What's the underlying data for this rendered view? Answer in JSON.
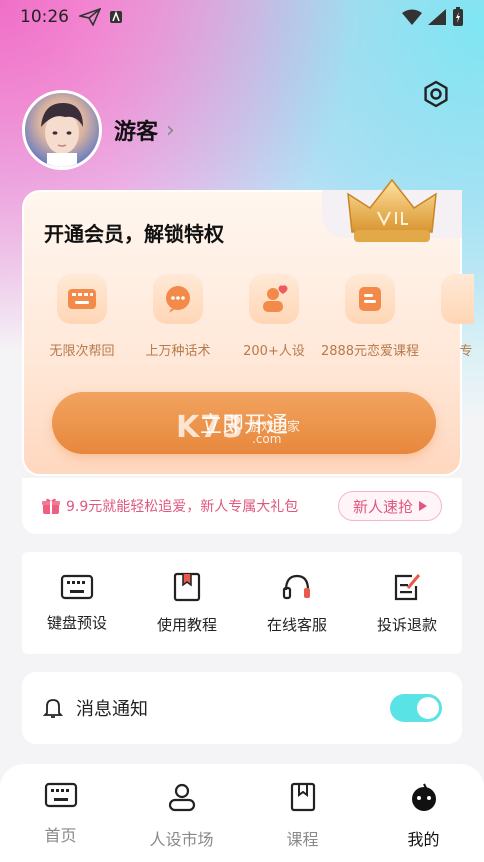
{
  "status_bar": {
    "time": "10:26"
  },
  "profile": {
    "username": "游客"
  },
  "vip": {
    "title": "开通会员，解锁特权",
    "perks": [
      {
        "label": "无限次帮回",
        "icon": "keyboard-icon"
      },
      {
        "label": "上万种话术",
        "icon": "chat-bubble-icon"
      },
      {
        "label": "200+人设",
        "icon": "persona-icon"
      },
      {
        "label": "2888元恋爱课程",
        "icon": "course-icon"
      },
      {
        "label": "专",
        "icon": "more-icon"
      }
    ],
    "join_label": "立即开通"
  },
  "watermark": {
    "main": "K73",
    "sub1": "游戏之家",
    "sub2": ".com"
  },
  "promo": {
    "text": "9.9元就能轻松追爱，新人专属大礼包",
    "button": "新人速抢"
  },
  "tools": [
    {
      "label": "键盘预设",
      "icon": "keyboard-icon"
    },
    {
      "label": "使用教程",
      "icon": "tutorial-book-icon"
    },
    {
      "label": "在线客服",
      "icon": "headset-icon"
    },
    {
      "label": "投诉退款",
      "icon": "complaint-edit-icon"
    }
  ],
  "notification": {
    "label": "消息通知",
    "enabled": true
  },
  "bottom_nav": [
    {
      "label": "首页",
      "icon": "keyboard-icon",
      "active": false
    },
    {
      "label": "人设市场",
      "icon": "person-icon",
      "active": false
    },
    {
      "label": "课程",
      "icon": "bookmark-icon",
      "active": false
    },
    {
      "label": "我的",
      "icon": "mascot-icon",
      "active": true
    }
  ],
  "colors": {
    "accent_cyan": "#59e3e5",
    "vip_orange": "#e7883c",
    "promo_pink": "#e0577f"
  }
}
